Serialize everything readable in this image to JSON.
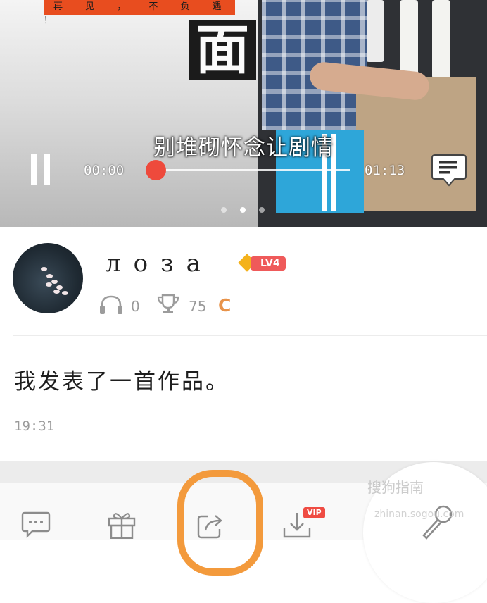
{
  "player": {
    "poster_banner": "再 见 ， 不 负 遇 ！",
    "poster_glyph": "面",
    "subtitle": "别堆砌怀念让剧情",
    "current_time": "00:00",
    "duration": "01:13",
    "progress_fraction": 0.0,
    "page_indicator": {
      "count": 3,
      "active_index": 1
    },
    "accent_color": "#ee4a3c"
  },
  "profile": {
    "username": "лоза",
    "level_badge": "LV4",
    "listen_count": "0",
    "trophy_count": "75",
    "c_mark": "C",
    "badge_color": "#ef5a5a",
    "c_mark_color": "#e8934a"
  },
  "post": {
    "text": "我发表了一首作品。",
    "time": "19:31"
  },
  "actions": {
    "items": [
      {
        "name": "comment",
        "icon": "comment-icon"
      },
      {
        "name": "gift",
        "icon": "gift-icon"
      },
      {
        "name": "share",
        "icon": "share-icon"
      },
      {
        "name": "download",
        "icon": "download-icon",
        "badge": "VIP"
      },
      {
        "name": "sing",
        "icon": "microphone-icon"
      }
    ],
    "vip_badge": "VIP",
    "highlight_color": "#f39a3c"
  },
  "watermark": {
    "text": "搜狗指南",
    "sub": "zhinan.sogou.com"
  }
}
